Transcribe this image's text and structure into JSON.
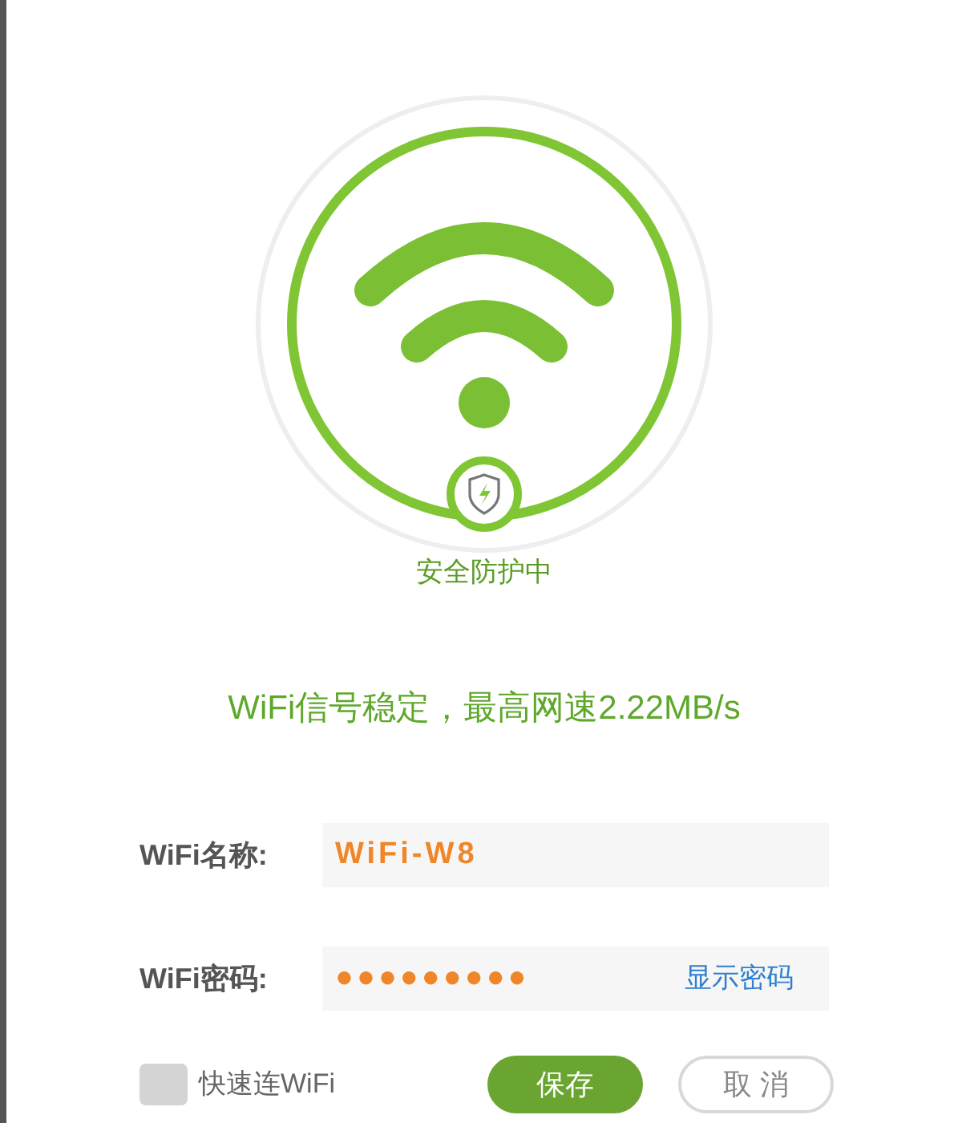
{
  "badge_label": "安全防护中",
  "status": "WiFi信号稳定，最高网速2.22MB/s",
  "fields": [
    {
      "label": "WiFi名称:",
      "value": "WiFi-W8"
    },
    {
      "label": "WiFi密码:",
      "value": "●●●●●●●●●",
      "action": "显示密码"
    }
  ],
  "quick_connect": {
    "label": "快速连WiFi",
    "checked": false
  },
  "buttons": [
    {
      "label": "保存",
      "kind": "primary"
    },
    {
      "label": "取 消",
      "kind": "secondary"
    }
  ]
}
